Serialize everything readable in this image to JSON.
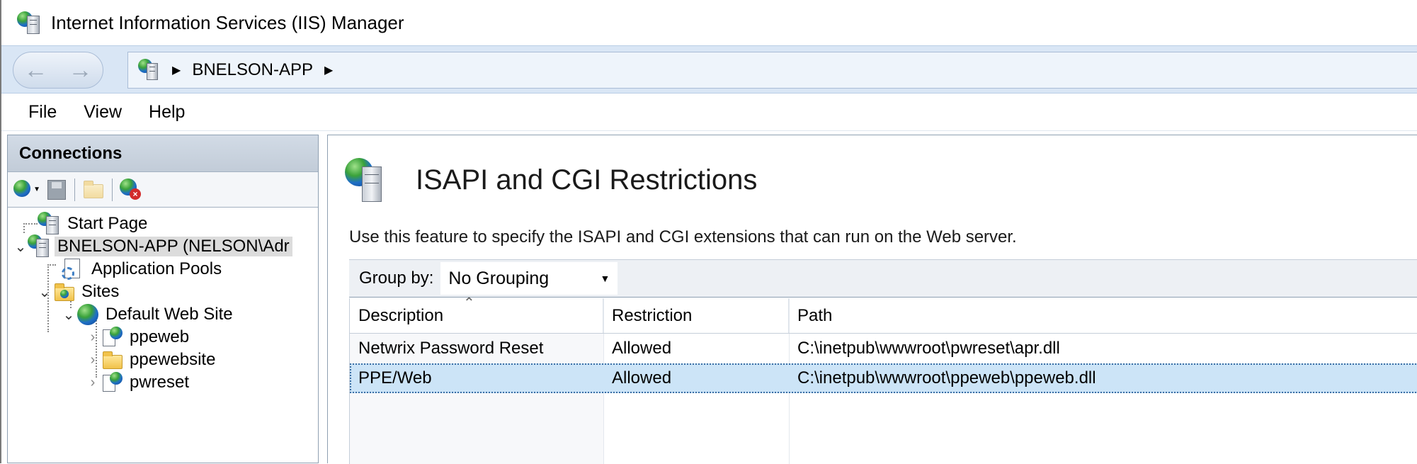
{
  "window": {
    "title": "Internet Information Services (IIS) Manager"
  },
  "address_bar": {
    "back_icon": "back-arrow-icon",
    "forward_icon": "forward-arrow-icon",
    "crumbs": [
      "BNELSON-APP"
    ]
  },
  "menu": {
    "items": [
      "File",
      "View",
      "Help"
    ]
  },
  "connections": {
    "title": "Connections",
    "toolbar_icons": [
      "connect-icon",
      "save-icon",
      "up-level-icon",
      "disconnect-icon"
    ],
    "tree": [
      {
        "label": "Start Page",
        "icon": "start-page-icon"
      },
      {
        "label": "BNELSON-APP (NELSON\\Adr",
        "icon": "server-icon",
        "expanded": true,
        "selected": true
      },
      {
        "label": "Application Pools",
        "icon": "app-pools-icon"
      },
      {
        "label": "Sites",
        "icon": "sites-folder-icon",
        "expanded": true
      },
      {
        "label": "Default Web Site",
        "icon": "globe-icon",
        "expanded": true
      },
      {
        "label": "ppeweb",
        "icon": "web-app-icon",
        "expanded": false
      },
      {
        "label": "ppewebsite",
        "icon": "folder-icon",
        "expanded": false
      },
      {
        "label": "pwreset",
        "icon": "web-app-icon",
        "expanded": false
      }
    ]
  },
  "feature": {
    "title": "ISAPI and CGI Restrictions",
    "description": "Use this feature to specify the ISAPI and CGI extensions that can run on the Web server.",
    "group_by_label": "Group by:",
    "group_by_value": "No Grouping",
    "columns": [
      "Description",
      "Restriction",
      "Path"
    ],
    "rows": [
      {
        "description": "Netwrix Password Reset",
        "restriction": "Allowed",
        "path": "C:\\inetpub\\wwwroot\\pwreset\\apr.dll",
        "selected": false
      },
      {
        "description": "PPE/Web",
        "restriction": "Allowed",
        "path": "C:\\inetpub\\wwwroot\\ppeweb\\ppeweb.dll",
        "selected": true
      }
    ]
  }
}
